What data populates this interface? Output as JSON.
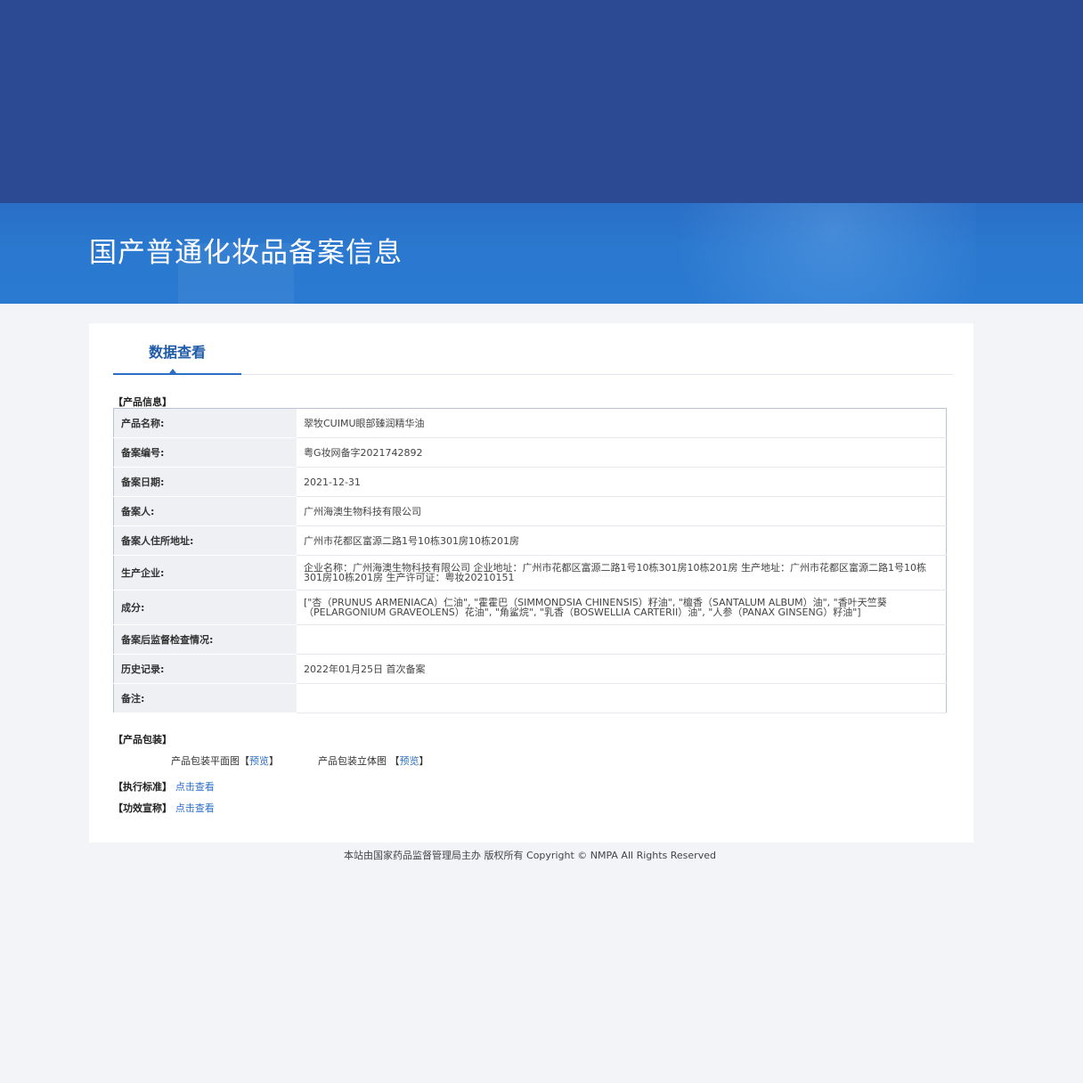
{
  "page": {
    "title": "国产普通化妆品备案信息"
  },
  "tab": {
    "label": "数据查看"
  },
  "product_info": {
    "section_label": "【产品信息】",
    "rows": [
      {
        "key": "产品名称:",
        "value": "翠牧CUIMU眼部臻润精华油"
      },
      {
        "key": "备案编号:",
        "value": "粤G妆网备字2021742892"
      },
      {
        "key": "备案日期:",
        "value": "2021-12-31"
      },
      {
        "key": "备案人:",
        "value": "广州海澳生物科技有限公司"
      },
      {
        "key": "备案人住所地址:",
        "value": "广州市花都区富源二路1号10栋301房10栋201房"
      },
      {
        "key": "生产企业:",
        "value": "企业名称：广州海澳生物科技有限公司 企业地址：广州市花都区富源二路1号10栋301房10栋201房 生产地址：广州市花都区富源二路1号10栋301房10栋201房 生产许可证：粤妆20210151"
      },
      {
        "key": "成分:",
        "value": "[\"杏（PRUNUS ARMENIACA）仁油\", \"霍霍巴（SIMMONDSIA CHINENSIS）籽油\", \"檀香（SANTALUM ALBUM）油\", \"香叶天竺葵（PELARGONIUM GRAVEOLENS）花油\", \"角鲨烷\", \"乳香（BOSWELLIA CARTERII）油\", \"人参（PANAX GINSENG）籽油\"]"
      },
      {
        "key": "备案后监督检查情况:",
        "value": ""
      },
      {
        "key": "历史记录:",
        "value": "2022年01月25日 首次备案"
      },
      {
        "key": "备注:",
        "value": ""
      }
    ]
  },
  "packaging": {
    "section_label": "【产品包装】",
    "flat_label": "产品包装平面图",
    "flat_preview": "预览",
    "solid_label": "产品包装立体图",
    "solid_preview": "预览",
    "bracket_open": "【",
    "bracket_close": "】"
  },
  "standard": {
    "label": "【执行标准】",
    "link": "点击查看"
  },
  "claims": {
    "label": "【功效宣称】",
    "link": "点击查看"
  },
  "footer": {
    "text": "本站由国家药品监督管理局主办 版权所有 Copyright © NMPA All Rights Reserved"
  }
}
